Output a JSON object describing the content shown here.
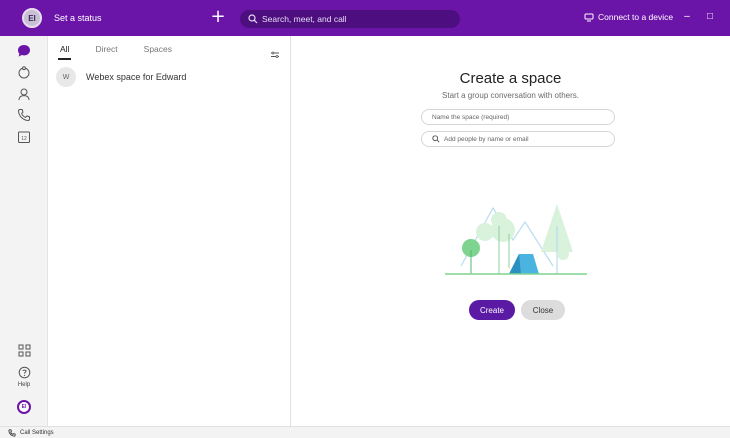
{
  "topbar": {
    "avatar_initials": "EI",
    "status_label": "Set a status",
    "plus_label": "+",
    "search_placeholder": "Search, meet, and call",
    "connect_label": "Connect to a device",
    "minimize_label": "–",
    "maximize_label": "□",
    "accent_color": "#6b14a8"
  },
  "rail": {
    "items": [
      {
        "name": "messaging",
        "icon": "chat-bubble-icon"
      },
      {
        "name": "teams",
        "icon": "people-icon"
      },
      {
        "name": "contacts",
        "icon": "person-icon"
      },
      {
        "name": "calling",
        "icon": "phone-icon"
      },
      {
        "name": "calendar",
        "icon": "calendar-icon"
      }
    ],
    "calendar_day": "12",
    "help_label": "Help",
    "user_initials": "EI"
  },
  "list": {
    "tabs": [
      {
        "label": "All",
        "active": true
      },
      {
        "label": "Direct",
        "active": false
      },
      {
        "label": "Spaces",
        "active": false
      }
    ],
    "spaces": [
      {
        "initial": "W",
        "name": "Webex space for Edward"
      }
    ]
  },
  "main": {
    "title": "Create a space",
    "subtitle": "Start a group conversation with others.",
    "name_placeholder": "Name the space (required)",
    "people_placeholder": "Add people by name or email",
    "create_label": "Create",
    "close_label": "Close"
  },
  "bottombar": {
    "label": "Call Settings"
  }
}
